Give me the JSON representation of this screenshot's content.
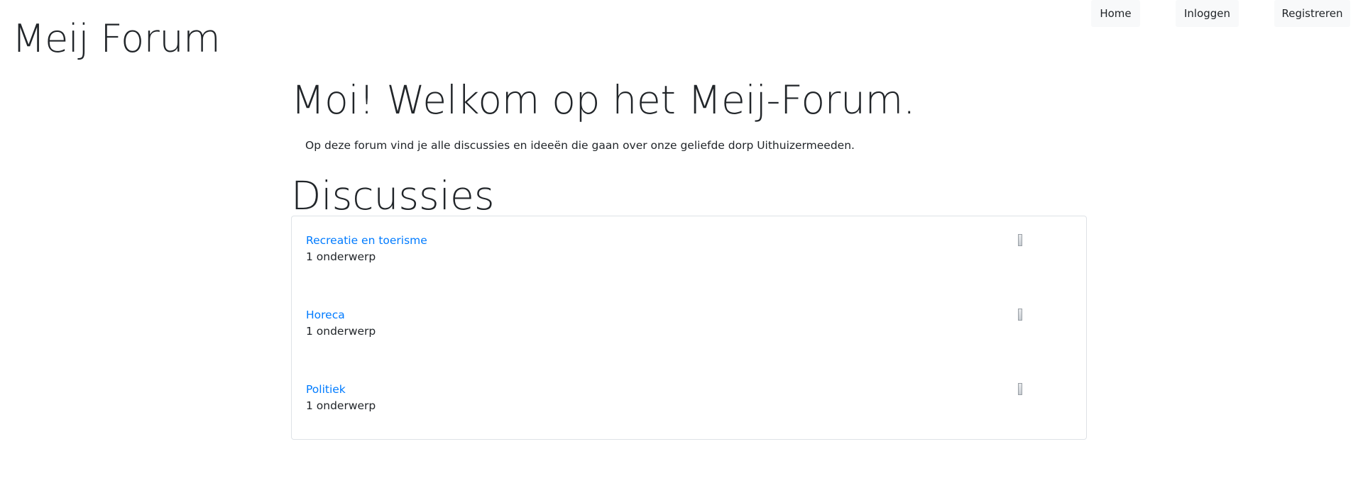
{
  "header": {
    "site_title": "Meij Forum",
    "nav": [
      {
        "label": "Home"
      },
      {
        "label": "Inloggen"
      },
      {
        "label": "Registreren"
      }
    ]
  },
  "main": {
    "welcome_title": "Moi! Welkom op het Meij-Forum.",
    "welcome_text": "Op deze forum vind je alle discussies en ideeën die gaan over onze geliefde dorp Uithuizermeeden.",
    "section_title": "Discussies",
    "discussions": [
      {
        "title": "Recreatie en toerisme",
        "count": "1 onderwerp",
        "icon": "broken-image-icon"
      },
      {
        "title": "Horeca",
        "count": "1 onderwerp",
        "icon": "broken-image-icon"
      },
      {
        "title": "Politiek",
        "count": "1 onderwerp",
        "icon": "broken-image-icon"
      }
    ]
  },
  "colors": {
    "link": "#007bff",
    "text": "#212529",
    "nav_bg": "#f8f9fa",
    "card_border": "#dee2e6"
  }
}
